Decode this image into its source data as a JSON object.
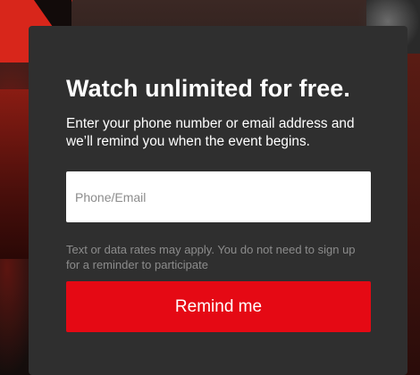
{
  "modal": {
    "title": "Watch unlimited for free.",
    "description": "Enter your phone number or email address and we’ll remind you when the event begins.",
    "input": {
      "value": "",
      "placeholder": "Phone/Email"
    },
    "note": "Text or data rates may apply. You do not need to sign up for a reminder to participate",
    "button_label": "Remind me"
  },
  "colors": {
    "card_background": "#2f2f2f",
    "button_red": "#e50914",
    "muted_text": "#8c8c8c"
  }
}
